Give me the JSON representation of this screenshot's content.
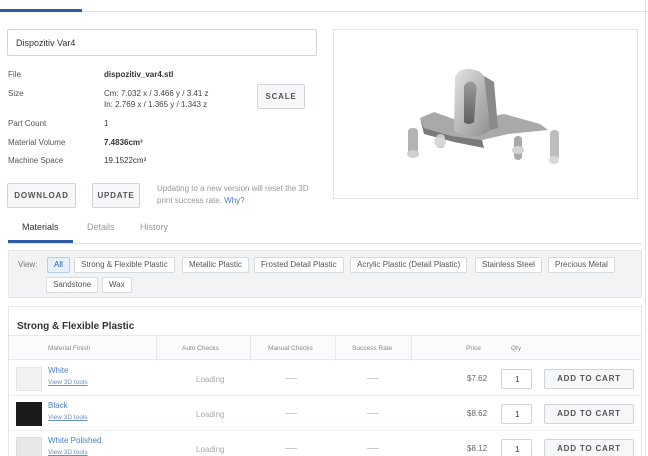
{
  "model": {
    "name_value": "Dispozitiv Var4"
  },
  "info": {
    "file_label": "File",
    "file_value": "dispozitiv_var4.stl",
    "size_label": "Size",
    "size_cm": "Cm: 7.032 x / 3.466 y / 3.41 z",
    "size_in": "In: 2.769 x / 1.365 y / 1.343 z",
    "part_count_label": "Part Count",
    "part_count_value": "1",
    "material_volume_label": "Material Volume",
    "material_volume_value": "7.4836cm³",
    "machine_space_label": "Machine Space",
    "machine_space_value": "19.1522cm³"
  },
  "buttons": {
    "scale": "SCALE",
    "download": "DOWNLOAD",
    "update": "UPDATE"
  },
  "update_note": {
    "text": "Updating to a new version will reset the 3D print success rate.",
    "link": "Why?"
  },
  "tabs": [
    {
      "label": "Materials",
      "active": true
    },
    {
      "label": "Details",
      "active": false
    },
    {
      "label": "History",
      "active": false
    }
  ],
  "filter": {
    "label": "View:",
    "chips": [
      "All",
      "Strong & Flexible Plastic",
      "Metallic Plastic",
      "Frosted Detail Plastic",
      "Acrylic Plastic (Detail Plastic)",
      "Stainless Steel",
      "Precious Metal",
      "Sandstone",
      "Wax"
    ],
    "active": "All"
  },
  "materials": {
    "section_title": "Strong & Flexible Plastic",
    "columns": [
      "Material Finish",
      "Auto Checks",
      "Manual Checks",
      "Success Rate",
      "Price",
      "Qty"
    ],
    "rows": [
      {
        "name": "White",
        "tools": "View 3D tools",
        "auto_checks": "Loading",
        "price": "$7.62",
        "qty": "1",
        "action": "ADD TO CART",
        "swatch": "#f2f2f2"
      },
      {
        "name": "Black",
        "tools": "View 3D tools",
        "auto_checks": "Loading",
        "price": "$8.62",
        "qty": "1",
        "action": "ADD TO CART",
        "swatch": "#1b1b1b"
      },
      {
        "name": "White Polished",
        "tools": "View 3D tools",
        "auto_checks": "Loading",
        "price": "$8.12",
        "qty": "1",
        "action": "ADD TO CART",
        "swatch": "#e8e8e8"
      }
    ]
  },
  "colors": {
    "accent": "#2a5ca8",
    "link": "#4a7fc0"
  }
}
